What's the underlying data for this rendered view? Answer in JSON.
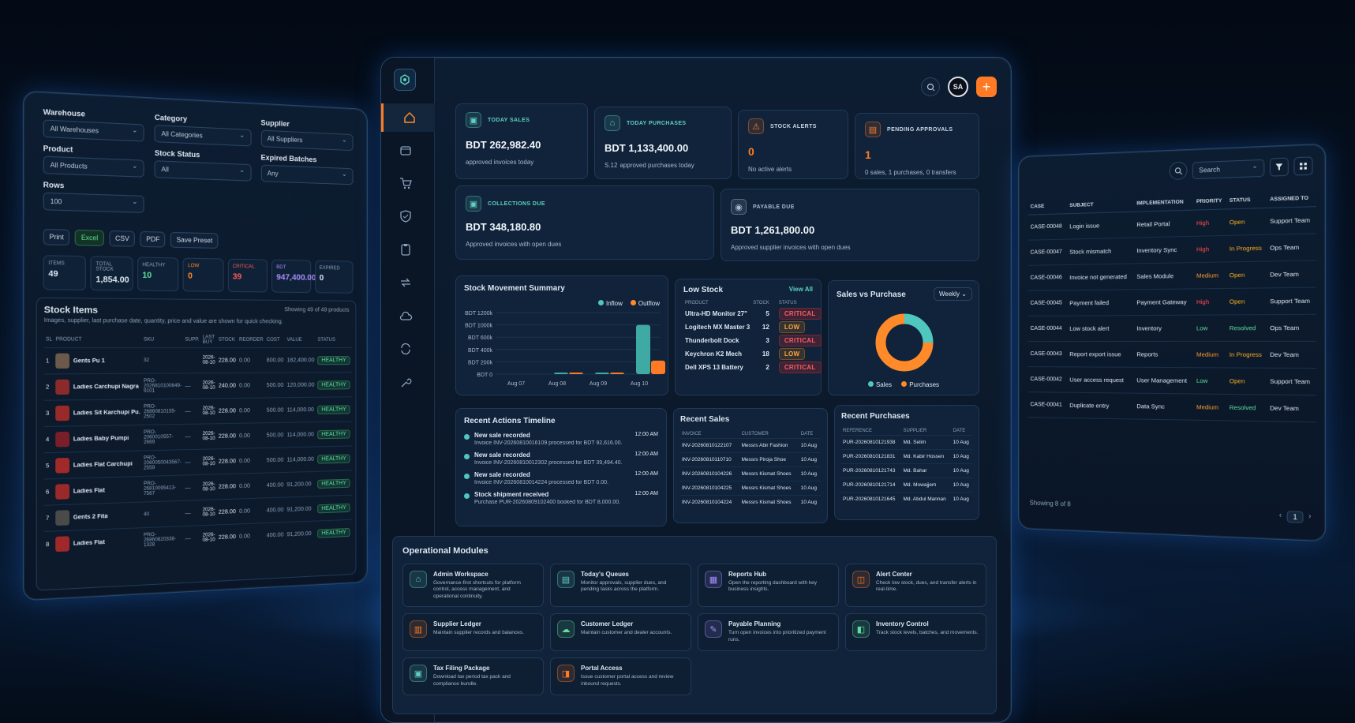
{
  "left": {
    "filters": {
      "warehouse_label": "Warehouse",
      "warehouse": "All Warehouses",
      "category_label": "Category",
      "category": "All Categories",
      "supplier_label": "Supplier",
      "supplier": "All Suppliers",
      "product_label": "Product",
      "product": "All Products",
      "stock_status_label": "Stock Status",
      "stock_status": "All",
      "expired_label": "Expired Batches",
      "expired": "Any",
      "rows_label": "Rows",
      "rows": "100"
    },
    "buttons": [
      "Print",
      "Excel",
      "CSV",
      "PDF",
      "Save Preset"
    ],
    "stats": [
      {
        "label": "ITEMS",
        "value": "49"
      },
      {
        "label": "TOTAL STOCK",
        "value": "1,854.00"
      },
      {
        "label": "HEALTHY",
        "value": "10"
      },
      {
        "label": "LOW",
        "value": "0"
      },
      {
        "label": "CRITICAL",
        "value": "39"
      },
      {
        "label": "BDT",
        "value": "947,400.00"
      },
      {
        "label": "EXPIRED",
        "value": "0"
      }
    ],
    "title": "Stock Items",
    "subtitle": "Images, supplier, last purchase date, quantity, price and value are shown for quick checking.",
    "showing": "Showing 49 of 49 products",
    "columns": [
      "SL",
      "PRODUCT",
      "SKU",
      "SUPP.",
      "LAST BUY",
      "STOCK",
      "REORDER",
      "COST",
      "VALUE",
      "STATUS"
    ],
    "rows": [
      {
        "sl": "1",
        "name": "Gents Pu 1",
        "sku": "32",
        "supp": "",
        "buy": "2026-08-10",
        "stock": "228.00",
        "reorder": "0.00",
        "cost": "800.00",
        "value": "182,400.00",
        "status": "HEALTHY"
      },
      {
        "sl": "2",
        "name": "Ladies Carchupi Nagra",
        "sku": "PRO-2026810100649-9101",
        "supp": "—",
        "buy": "2026-08-10",
        "stock": "240.00",
        "reorder": "0.00",
        "cost": "500.00",
        "value": "120,000.00",
        "status": "HEALTHY"
      },
      {
        "sl": "3",
        "name": "Ladies Sit Karchupi Pu...",
        "sku": "PRO-26860810155-2502",
        "supp": "—",
        "buy": "2026-08-10",
        "stock": "228.00",
        "reorder": "0.00",
        "cost": "500.00",
        "value": "114,000.00",
        "status": "HEALTHY"
      },
      {
        "sl": "4",
        "name": "Ladies Baby Pumpi",
        "sku": "PRO-2060010557-2669",
        "supp": "—",
        "buy": "2026-08-10",
        "stock": "228.00",
        "reorder": "0.00",
        "cost": "500.00",
        "value": "114,000.00",
        "status": "HEALTHY"
      },
      {
        "sl": "5",
        "name": "Ladies Flat Carchupi",
        "sku": "PRO-2060050043567-2559",
        "supp": "—",
        "buy": "2026-08-10",
        "stock": "228.00",
        "reorder": "0.00",
        "cost": "500.00",
        "value": "114,000.00",
        "status": "HEALTHY"
      },
      {
        "sl": "6",
        "name": "Ladies Flat",
        "sku": "PRO-26810095413-7567",
        "supp": "—",
        "buy": "2026-08-10",
        "stock": "228.00",
        "reorder": "0.00",
        "cost": "400.00",
        "value": "91,200.00",
        "status": "HEALTHY"
      },
      {
        "sl": "7",
        "name": "Gents 2 Fita",
        "sku": "40",
        "supp": "—",
        "buy": "2026-08-10",
        "stock": "228.00",
        "reorder": "0.00",
        "cost": "400.00",
        "value": "91,200.00",
        "status": "HEALTHY"
      },
      {
        "sl": "8",
        "name": "Ladies Flat",
        "sku": "PRO-26860820338-1328",
        "supp": "—",
        "buy": "2026-08-10",
        "stock": "228.00",
        "reorder": "0.00",
        "cost": "400.00",
        "value": "91,200.00",
        "status": "HEALTHY"
      }
    ]
  },
  "center": {
    "avatar": "SA",
    "kpis": [
      {
        "title": "TODAY SALES",
        "value": "BDT 262,982.40",
        "sub": "approved invoices today",
        "color": "#5fd0c0"
      },
      {
        "title": "TODAY PURCHASES",
        "value": "BDT 1,133,400.00",
        "sub": "approved purchases today",
        "prefix": "S.12",
        "color": "#5fd0c0"
      },
      {
        "title": "STOCK ALERTS",
        "value": "0",
        "sub": "No active alerts",
        "color": "#ff7a24"
      },
      {
        "title": "PENDING APPROVALS",
        "value": "1",
        "sub": "0 sales, 1 purchases, 0 transfers",
        "color": "#ff7a24"
      }
    ],
    "kpis2": [
      {
        "title": "COLLECTIONS DUE",
        "value": "BDT 348,180.80",
        "sub": "Approved invoices with open dues",
        "color": "#5fd0c0"
      },
      {
        "title": "PAYABLE DUE",
        "value": "BDT 1,261,800.00",
        "sub": "Approved supplier invoices with open dues",
        "color": "#a9b8cc"
      }
    ],
    "movement": {
      "title": "Stock Movement Summary",
      "legend": [
        "Inflow",
        "Outflow"
      ]
    },
    "low_stock": {
      "title": "Low Stock",
      "view_all": "View All",
      "columns": [
        "PRODUCT",
        "STOCK",
        "STATUS"
      ],
      "rows": [
        {
          "p": "Ultra-HD Monitor 27\"",
          "s": "5",
          "st": "CRITICAL"
        },
        {
          "p": "Logitech MX Master 3",
          "s": "12",
          "st": "LOW"
        },
        {
          "p": "Thunderbolt Dock",
          "s": "3",
          "st": "CRITICAL"
        },
        {
          "p": "Keychron K2 Mech",
          "s": "18",
          "st": "LOW"
        },
        {
          "p": "Dell XPS 13 Battery",
          "s": "2",
          "st": "CRITICAL"
        }
      ]
    },
    "svp": {
      "title": "Sales vs Purchase",
      "period": "Weekly",
      "legend": [
        "Sales",
        "Purchases"
      ]
    },
    "timeline": {
      "title": "Recent Actions Timeline",
      "items": [
        {
          "t": "New sale recorded",
          "d": "Invoice INV-20260810016109 processed for BDT 92,616.00.",
          "time": "12:00 AM"
        },
        {
          "t": "New sale recorded",
          "d": "Invoice INV-20260810012302 processed for BDT 39,494.40.",
          "time": "12:00 AM"
        },
        {
          "t": "New sale recorded",
          "d": "Invoice INV-20260810014224 processed for BDT 0.00.",
          "time": "12:00 AM"
        },
        {
          "t": "Stock shipment received",
          "d": "Purchase PUR-20260809102400 booked for BDT 8,000.00.",
          "time": "12:00 AM"
        }
      ]
    },
    "recent_sales": {
      "title": "Recent Sales",
      "columns": [
        "INVOICE",
        "CUSTOMER",
        "DATE"
      ],
      "rows": [
        [
          "INV-20260810122107",
          "Messrs Abir Fashion",
          "10 Aug"
        ],
        [
          "INV-20260810110710",
          "Messrs Piroja Shoe",
          "10 Aug"
        ],
        [
          "INV-20260810104226",
          "Messrs Kismat Shoes",
          "10 Aug"
        ],
        [
          "INV-20260810104225",
          "Messrs Kismat Shoes",
          "10 Aug"
        ],
        [
          "INV-20260810104224",
          "Messrs Kismat Shoes",
          "10 Aug"
        ]
      ]
    },
    "recent_purchases": {
      "title": "Recent Purchases",
      "columns": [
        "REFERENCE",
        "SUPPLIER",
        "DATE"
      ],
      "rows": [
        [
          "PUR-20260810121938",
          "Md. Selim",
          "10 Aug"
        ],
        [
          "PUR-20260810121831",
          "Md. Kabir Hossen",
          "10 Aug"
        ],
        [
          "PUR-20260810121743",
          "Md. Bahar",
          "10 Aug"
        ],
        [
          "PUR-20260810121714",
          "Md. Mowajjem",
          "10 Aug"
        ],
        [
          "PUR-20260810121645",
          "Md. Abdul Mannan",
          "10 Aug"
        ]
      ]
    },
    "modules_title": "Operational Modules",
    "modules": [
      {
        "t": "Admin Workspace",
        "d": "Governance-first shortcuts for platform control, access management, and operational continuity.",
        "c": "#5fd0c0"
      },
      {
        "t": "Today's Queues",
        "d": "Monitor approvals, supplier dues, and pending tasks across the platform.",
        "c": "#5fd0c0"
      },
      {
        "t": "Reports Hub",
        "d": "Open the reporting dashboard with key business insights.",
        "c": "#a88cff"
      },
      {
        "t": "Alert Center",
        "d": "Check low stock, dues, and transfer alerts in real-time.",
        "c": "#ff7a24"
      },
      {
        "t": "Supplier Ledger",
        "d": "Maintain supplier records and balances.",
        "c": "#ff7a24"
      },
      {
        "t": "Customer Ledger",
        "d": "Maintain customer and dealer accounts.",
        "c": "#5fe09a"
      },
      {
        "t": "Payable Planning",
        "d": "Turn open invoices into prioritized payment runs.",
        "c": "#a88cff"
      },
      {
        "t": "Inventory Control",
        "d": "Track stock levels, batches, and movements.",
        "c": "#5fe09a"
      },
      {
        "t": "Tax Filing Package",
        "d": "Download tax period tax pack and compliance bundle.",
        "c": "#5fd0c0"
      },
      {
        "t": "Portal Access",
        "d": "Issue customer portal access and review inbound requests.",
        "c": "#ff7a24"
      }
    ]
  },
  "chart_data": [
    {
      "type": "bar",
      "title": "Stock Movement Summary",
      "categories": [
        "Aug 07",
        "Aug 08",
        "Aug 09",
        "Aug 10"
      ],
      "yticks": [
        "BDT 0",
        "BDT 200k",
        "BDT 400k",
        "BDT 600k",
        "BDT 1000k",
        "BDT 1200k"
      ],
      "ylim": [
        0,
        1200000
      ],
      "series": [
        {
          "name": "Inflow",
          "values": [
            0,
            8000,
            20000,
            1000000
          ]
        },
        {
          "name": "Outflow",
          "values": [
            0,
            25000,
            10000,
            220000
          ]
        }
      ],
      "legend": "top-right"
    },
    {
      "type": "pie",
      "title": "Sales vs Purchase",
      "series": [
        {
          "name": "Sales",
          "value": 25
        },
        {
          "name": "Purchases",
          "value": 75
        }
      ],
      "colors": [
        "#4fc7bf",
        "#ff8a2a"
      ]
    }
  ],
  "right": {
    "search": "Search",
    "columns": [
      "CASE",
      "SUBJECT",
      "IMPLEMENTATION",
      "PRIORITY",
      "STATUS",
      "ASSIGNED TO"
    ],
    "rows": [
      [
        "CASE-00048",
        "Login issue",
        "Retail Portal",
        "High",
        "Open",
        "Support Team"
      ],
      [
        "CASE-00047",
        "Stock mismatch",
        "Inventory Sync",
        "High",
        "In Progress",
        "Ops Team"
      ],
      [
        "CASE-00046",
        "Invoice not generated",
        "Sales Module",
        "Medium",
        "Open",
        "Dev Team"
      ],
      [
        "CASE-00045",
        "Payment failed",
        "Payment Gateway",
        "High",
        "Open",
        "Support Team"
      ],
      [
        "CASE-00044",
        "Low stock alert",
        "Inventory",
        "Low",
        "Resolved",
        "Ops Team"
      ],
      [
        "CASE-00043",
        "Report export issue",
        "Reports",
        "Medium",
        "In Progress",
        "Dev Team"
      ],
      [
        "CASE-00042",
        "User access request",
        "User Management",
        "Low",
        "Open",
        "Support Team"
      ],
      [
        "CASE-00041",
        "Duplicate entry",
        "Data Sync",
        "Medium",
        "Resolved",
        "Dev Team"
      ]
    ],
    "showing": "Showing 8 of 8",
    "page": "1"
  }
}
